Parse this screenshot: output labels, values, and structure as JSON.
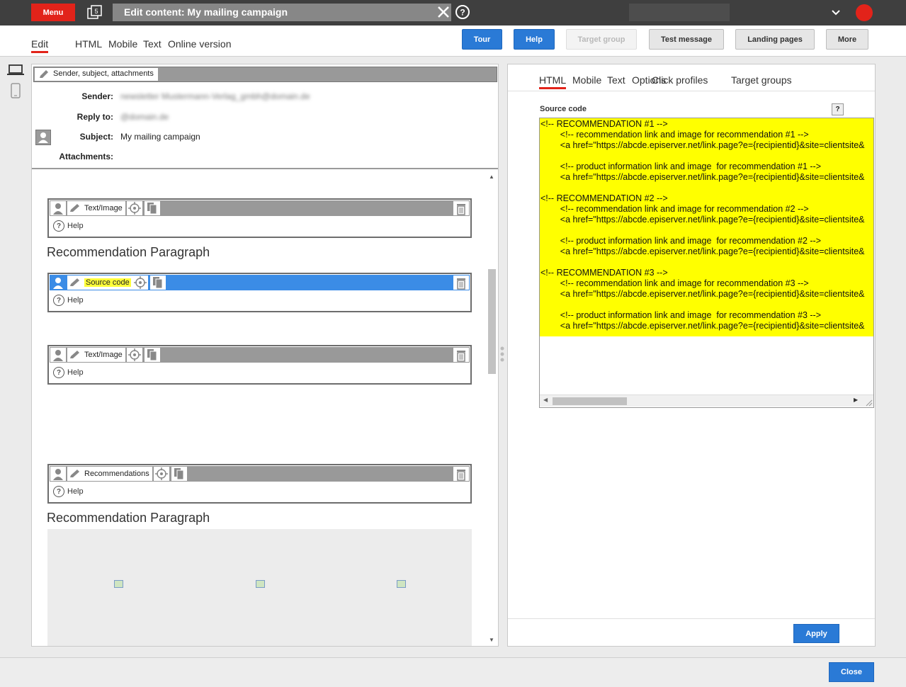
{
  "topbar": {
    "menu_label": "Menu",
    "windows_count": "5",
    "title": "Edit content: My mailing campaign",
    "accent_color": "#e2231a"
  },
  "mode_tabs": [
    {
      "label": "Edit",
      "active": true
    },
    {
      "label": "HTML"
    },
    {
      "label": "Mobile"
    },
    {
      "label": "Text"
    },
    {
      "label": "Online version"
    }
  ],
  "toolbar": {
    "tour": "Tour",
    "help": "Help",
    "target_group": "Target group",
    "test_message": "Test message",
    "landing_pages": "Landing pages",
    "more": "More"
  },
  "header_section": {
    "bar_label": "Sender, subject, attachments",
    "sender_label": "Sender:",
    "sender_value": "newsletter Mustermann-Verlag_gmbh@domain.de",
    "reply_label": "Reply to:",
    "reply_value": "@domain.de",
    "subject_label": "Subject:",
    "subject_value": "My mailing campaign",
    "attachments_label": "Attachments:"
  },
  "modules": [
    {
      "label": "Text/Image",
      "help": "Help"
    },
    {
      "label": "Source code",
      "help": "Help",
      "selected": true
    },
    {
      "label": "Text/Image",
      "help": "Help"
    },
    {
      "label": "Recommendations",
      "help": "Help"
    }
  ],
  "paragraph_titles": [
    "Recommendation Paragraph",
    "Recommendation Paragraph"
  ],
  "right_panel": {
    "tabs": [
      {
        "label": "HTML",
        "active": true
      },
      {
        "label": "Mobile"
      },
      {
        "label": "Text"
      },
      {
        "label": "Options"
      },
      {
        "label": "Click profiles"
      },
      {
        "label": "Target groups"
      }
    ],
    "source_label": "Source code",
    "help_mark": "?",
    "code_lines": [
      "<!-- RECOMMENDATION #1 -->",
      "        <!-- recommendation link and image for recommendation #1 -->",
      "        <a href=\"https://abcde.episerver.net/link.page?e={recipientid}&site=clientsite&",
      "",
      "        <!-- product information link and image  for recommendation #1 -->",
      "        <a href=\"https://abcde.episerver.net/link.page?e={recipientid}&site=clientsite&",
      "",
      "<!-- RECOMMENDATION #2 -->",
      "        <!-- recommendation link and image for recommendation #2 -->",
      "        <a href=\"https://abcde.episerver.net/link.page?e={recipientid}&site=clientsite&",
      "",
      "        <!-- product information link and image  for recommendation #2 -->",
      "        <a href=\"https://abcde.episerver.net/link.page?e={recipientid}&site=clientsite&",
      "",
      "<!-- RECOMMENDATION #3 -->",
      "        <!-- recommendation link and image for recommendation #3 -->",
      "        <a href=\"https://abcde.episerver.net/link.page?e={recipientid}&site=clientsite&",
      "",
      "        <!-- product information link and image  for recommendation #3 -->",
      "        <a href=\"https://abcde.episerver.net/link.page?e={recipientid}&site=clientsite&"
    ],
    "apply": "Apply"
  },
  "footer": {
    "close": "Close"
  }
}
